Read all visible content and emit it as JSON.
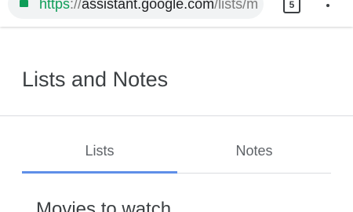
{
  "browser": {
    "url_scheme": "https",
    "url_separator": "://",
    "url_host": "assistant.google.com",
    "url_path": "/lists/main\\",
    "tab_count": "5"
  },
  "app": {
    "title": "Lists and Notes"
  },
  "tabs": [
    {
      "label": "Lists",
      "selected": true
    },
    {
      "label": "Notes",
      "selected": false
    }
  ],
  "lists": [
    {
      "title": "Movies to watch"
    }
  ],
  "colors": {
    "accent": "#5f8fe8",
    "secure_green": "#0f9d58",
    "text_primary": "#3c4043",
    "text_secondary": "#5f6368",
    "divider": "#dadce0"
  }
}
